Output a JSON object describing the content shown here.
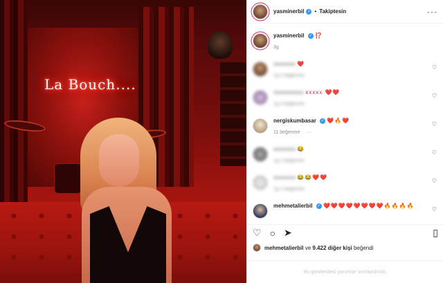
{
  "post": {
    "author": "yasminerbil",
    "follow_state": "Takiptesin",
    "caption_emoji": "⁉️",
    "time_ago": "3g",
    "neon_sign": "La Bouch...."
  },
  "comments": [
    {
      "user": "xxxxxxxx",
      "text": "❤️",
      "meta": "1g  2 beğenme",
      "blurred": true
    },
    {
      "user": "xxxxxxxxxxx",
      "text": "xxxxx ❤️❤️",
      "meta": "1g  3 beğenme",
      "blurred": true
    },
    {
      "user": "nergiskumbasar",
      "text": "❤️🔥❤️",
      "meta": "11 beğenme",
      "blurred": false
    },
    {
      "user": "xxxxxxxx",
      "text": "😂",
      "meta": "1g  1 beğenme",
      "blurred": true
    },
    {
      "user": "xxxxxxxx",
      "text": "😂😂❤️❤️",
      "meta": "1g  1 beğenme",
      "blurred": true
    },
    {
      "user": "mehmetalierbil",
      "text": "❤️❤️❤️❤️❤️❤️❤️❤️🔥🔥🔥🔥",
      "meta": "",
      "blurred": false
    }
  ],
  "likes": {
    "first_user": "mehmetalierbil",
    "joiner": " ve ",
    "others": "9.422 diğer kişi",
    "suffix": " beğendi"
  },
  "footer": "Bu gönderideki yorumlar sınırlandırıldı.",
  "icons": {
    "heart": "heart-icon",
    "comment": "comment-icon",
    "share": "share-icon",
    "save": "bookmark-icon",
    "verified": "verified-badge-icon"
  },
  "colors": {
    "verified": "#3897f0",
    "accent_heart": "#e0245e"
  }
}
